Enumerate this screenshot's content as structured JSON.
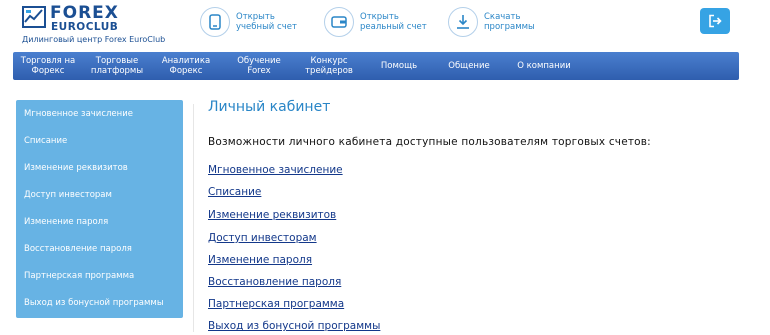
{
  "brand": {
    "name_line1": "FOREX",
    "name_line2": "EUROCLUB",
    "tagline": "Дилинговый центр Forex EuroClub",
    "color": "#1b4f93"
  },
  "header_buttons": [
    {
      "line1": "Открыть",
      "line2": "учебный счет",
      "icon": "open-demo-account-icon"
    },
    {
      "line1": "Открыть",
      "line2": "реальный счет",
      "icon": "open-real-account-icon"
    },
    {
      "line1": "Скачать",
      "line2": "программы",
      "icon": "download-icon"
    }
  ],
  "logout": {
    "icon": "logout-icon",
    "color": "#36a3e4"
  },
  "nav": {
    "items": [
      {
        "line1": "Торговля на",
        "line2": "Форекс"
      },
      {
        "line1": "Торговые",
        "line2": "платформы"
      },
      {
        "line1": "Аналитика",
        "line2": "Форекс"
      },
      {
        "line1": "Обучение",
        "line2": "Forex"
      },
      {
        "line1": "Конкурс",
        "line2": "трейдеров"
      },
      {
        "line1": "Помощь",
        "line2": ""
      },
      {
        "line1": "Общение",
        "line2": ""
      },
      {
        "line1": "О компании",
        "line2": ""
      }
    ]
  },
  "sidebar": {
    "items": [
      "Мгновенное зачисление",
      "Списание",
      "Изменение реквизитов",
      "Доступ инвесторам",
      "Изменение пароля",
      "Восстановление пароля",
      "Партнерская программа",
      "Выход из бонусной программы"
    ]
  },
  "main": {
    "title": "Личный кабинет",
    "intro": "Возможности личного кабинета доступные пользователям торговых счетов:",
    "links": [
      "Мгновенное зачисление",
      "Списание",
      "Изменение реквизитов",
      "Доступ инвесторам",
      "Изменение пароля",
      "Восстановление пароля",
      "Партнерская программа",
      "Выход из бонусной программы"
    ]
  },
  "colors": {
    "nav": "#2f5eae",
    "sidebar": "#67b3e4",
    "link": "#13388a",
    "accent": "#2a86c7"
  }
}
